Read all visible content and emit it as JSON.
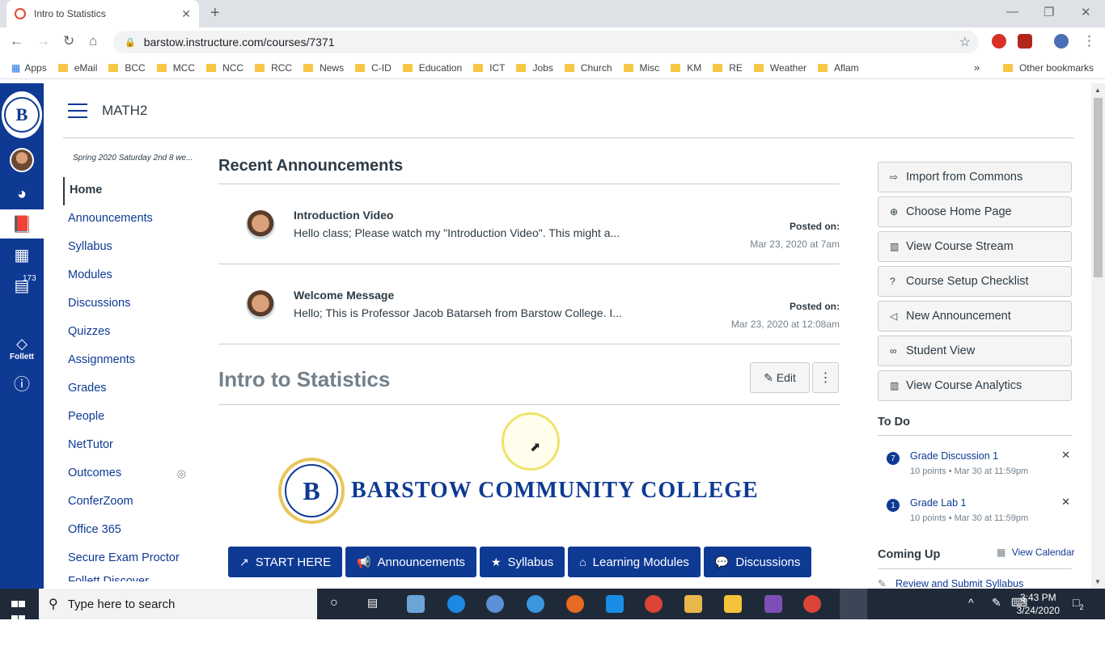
{
  "browser": {
    "tab_title": "Intro to Statistics",
    "tab_close": "✕",
    "new_tab": "+",
    "url": "barstow.instructure.com/courses/7371",
    "bookmarks": [
      "eMail",
      "BCC",
      "MCC",
      "NCC",
      "RCC",
      "News",
      "C-ID",
      "Education",
      "ICT",
      "Jobs",
      "Church",
      "Misc",
      "KM",
      "RE",
      "Weather",
      "Aflam"
    ],
    "apps_label": "Apps",
    "other_bookmarks": "Other bookmarks",
    "overflow": "»"
  },
  "global_nav": {
    "logo_letter": "B",
    "inbox_badge": "173",
    "follett_label": "Follett"
  },
  "header": {
    "course_code": "MATH2"
  },
  "course_nav": {
    "term": "Spring 2020 Saturday 2nd 8 we...",
    "items": [
      "Home",
      "Announcements",
      "Syllabus",
      "Modules",
      "Discussions",
      "Quizzes",
      "Assignments",
      "Grades",
      "People",
      "NetTutor",
      "Outcomes",
      "ConferZoom",
      "Office 365",
      "Secure Exam Proctor",
      "Follett Discover"
    ]
  },
  "main": {
    "recent_heading": "Recent Announcements",
    "announcements": [
      {
        "title": "Introduction Video",
        "body": "Hello class; Please watch my \"Introduction Video\". This might a...",
        "posted_label": "Posted on:",
        "date": "Mar 23, 2020 at 7am"
      },
      {
        "title": "Welcome Message",
        "body": "Hello; This is Professor Jacob Batarseh from Barstow College. I...",
        "posted_label": "Posted on:",
        "date": "Mar 23, 2020 at 12:08am"
      }
    ],
    "page_title": "Intro to Statistics",
    "edit_label": "Edit",
    "more_label": "⋮",
    "college_name": "BARSTOW COMMUNITY COLLEGE",
    "seal_letter": "B",
    "buttons": [
      {
        "label": "START HERE",
        "icon": "↗"
      },
      {
        "label": "Announcements",
        "icon": "📢"
      },
      {
        "label": "Syllabus",
        "icon": "★"
      },
      {
        "label": "Learning Modules",
        "icon": "⌂"
      },
      {
        "label": "Discussions",
        "icon": "💬"
      }
    ]
  },
  "sidebar": {
    "actions": [
      {
        "label": "Import from Commons",
        "icon": "⇨"
      },
      {
        "label": "Choose Home Page",
        "icon": "⊕"
      },
      {
        "label": "View Course Stream",
        "icon": "▥"
      },
      {
        "label": "Course Setup Checklist",
        "icon": "?"
      },
      {
        "label": "New Announcement",
        "icon": "◁"
      },
      {
        "label": "Student View",
        "icon": "∞"
      },
      {
        "label": "View Course Analytics",
        "icon": "▥"
      }
    ],
    "todo_heading": "To Do",
    "todos": [
      {
        "count": "7",
        "title": "Grade Discussion 1",
        "meta": "10 points • Mar 30 at 11:59pm"
      },
      {
        "count": "1",
        "title": "Grade Lab 1",
        "meta": "10 points • Mar 30 at 11:59pm"
      }
    ],
    "coming_up_heading": "Coming Up",
    "view_calendar": "View Calendar",
    "coming_item": "Review and Submit Syllabus"
  },
  "taskbar": {
    "search_placeholder": "Type here to search",
    "time": "3:43 PM",
    "date": "3/24/2020",
    "notif_count": "2"
  },
  "colors": {
    "brand": "#0e3a94",
    "text": "#2d3b45",
    "muted": "#73818c"
  }
}
